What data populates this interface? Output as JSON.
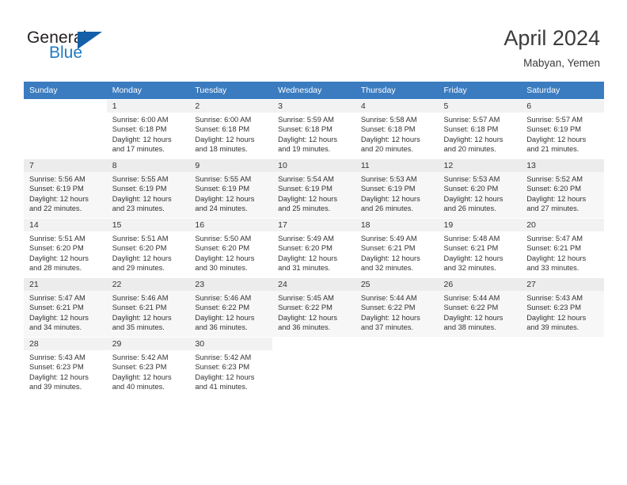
{
  "brand": {
    "name_top": "General",
    "name_bottom": "Blue",
    "triangle_color": "#1360a8",
    "blue_color": "#1f7ac4"
  },
  "header": {
    "title": "April 2024",
    "location": "Mabyan, Yemen"
  },
  "calendar": {
    "header_bg": "#3b7cc0",
    "header_text_color": "#ffffff",
    "weekday_headers": [
      "Sunday",
      "Monday",
      "Tuesday",
      "Wednesday",
      "Thursday",
      "Friday",
      "Saturday"
    ],
    "labels": {
      "sunrise": "Sunrise:",
      "sunset": "Sunset:",
      "daylight": "Daylight:"
    },
    "weeks": [
      [
        {
          "day": "",
          "empty": true
        },
        {
          "day": "1",
          "sunrise": "Sunrise: 6:00 AM",
          "sunset": "Sunset: 6:18 PM",
          "daylight_line1": "Daylight: 12 hours",
          "daylight_line2": "and 17 minutes."
        },
        {
          "day": "2",
          "sunrise": "Sunrise: 6:00 AM",
          "sunset": "Sunset: 6:18 PM",
          "daylight_line1": "Daylight: 12 hours",
          "daylight_line2": "and 18 minutes."
        },
        {
          "day": "3",
          "sunrise": "Sunrise: 5:59 AM",
          "sunset": "Sunset: 6:18 PM",
          "daylight_line1": "Daylight: 12 hours",
          "daylight_line2": "and 19 minutes."
        },
        {
          "day": "4",
          "sunrise": "Sunrise: 5:58 AM",
          "sunset": "Sunset: 6:18 PM",
          "daylight_line1": "Daylight: 12 hours",
          "daylight_line2": "and 20 minutes."
        },
        {
          "day": "5",
          "sunrise": "Sunrise: 5:57 AM",
          "sunset": "Sunset: 6:18 PM",
          "daylight_line1": "Daylight: 12 hours",
          "daylight_line2": "and 20 minutes."
        },
        {
          "day": "6",
          "sunrise": "Sunrise: 5:57 AM",
          "sunset": "Sunset: 6:19 PM",
          "daylight_line1": "Daylight: 12 hours",
          "daylight_line2": "and 21 minutes."
        }
      ],
      [
        {
          "day": "7",
          "sunrise": "Sunrise: 5:56 AM",
          "sunset": "Sunset: 6:19 PM",
          "daylight_line1": "Daylight: 12 hours",
          "daylight_line2": "and 22 minutes."
        },
        {
          "day": "8",
          "sunrise": "Sunrise: 5:55 AM",
          "sunset": "Sunset: 6:19 PM",
          "daylight_line1": "Daylight: 12 hours",
          "daylight_line2": "and 23 minutes."
        },
        {
          "day": "9",
          "sunrise": "Sunrise: 5:55 AM",
          "sunset": "Sunset: 6:19 PM",
          "daylight_line1": "Daylight: 12 hours",
          "daylight_line2": "and 24 minutes."
        },
        {
          "day": "10",
          "sunrise": "Sunrise: 5:54 AM",
          "sunset": "Sunset: 6:19 PM",
          "daylight_line1": "Daylight: 12 hours",
          "daylight_line2": "and 25 minutes."
        },
        {
          "day": "11",
          "sunrise": "Sunrise: 5:53 AM",
          "sunset": "Sunset: 6:19 PM",
          "daylight_line1": "Daylight: 12 hours",
          "daylight_line2": "and 26 minutes."
        },
        {
          "day": "12",
          "sunrise": "Sunrise: 5:53 AM",
          "sunset": "Sunset: 6:20 PM",
          "daylight_line1": "Daylight: 12 hours",
          "daylight_line2": "and 26 minutes."
        },
        {
          "day": "13",
          "sunrise": "Sunrise: 5:52 AM",
          "sunset": "Sunset: 6:20 PM",
          "daylight_line1": "Daylight: 12 hours",
          "daylight_line2": "and 27 minutes."
        }
      ],
      [
        {
          "day": "14",
          "sunrise": "Sunrise: 5:51 AM",
          "sunset": "Sunset: 6:20 PM",
          "daylight_line1": "Daylight: 12 hours",
          "daylight_line2": "and 28 minutes."
        },
        {
          "day": "15",
          "sunrise": "Sunrise: 5:51 AM",
          "sunset": "Sunset: 6:20 PM",
          "daylight_line1": "Daylight: 12 hours",
          "daylight_line2": "and 29 minutes."
        },
        {
          "day": "16",
          "sunrise": "Sunrise: 5:50 AM",
          "sunset": "Sunset: 6:20 PM",
          "daylight_line1": "Daylight: 12 hours",
          "daylight_line2": "and 30 minutes."
        },
        {
          "day": "17",
          "sunrise": "Sunrise: 5:49 AM",
          "sunset": "Sunset: 6:20 PM",
          "daylight_line1": "Daylight: 12 hours",
          "daylight_line2": "and 31 minutes."
        },
        {
          "day": "18",
          "sunrise": "Sunrise: 5:49 AM",
          "sunset": "Sunset: 6:21 PM",
          "daylight_line1": "Daylight: 12 hours",
          "daylight_line2": "and 32 minutes."
        },
        {
          "day": "19",
          "sunrise": "Sunrise: 5:48 AM",
          "sunset": "Sunset: 6:21 PM",
          "daylight_line1": "Daylight: 12 hours",
          "daylight_line2": "and 32 minutes."
        },
        {
          "day": "20",
          "sunrise": "Sunrise: 5:47 AM",
          "sunset": "Sunset: 6:21 PM",
          "daylight_line1": "Daylight: 12 hours",
          "daylight_line2": "and 33 minutes."
        }
      ],
      [
        {
          "day": "21",
          "sunrise": "Sunrise: 5:47 AM",
          "sunset": "Sunset: 6:21 PM",
          "daylight_line1": "Daylight: 12 hours",
          "daylight_line2": "and 34 minutes."
        },
        {
          "day": "22",
          "sunrise": "Sunrise: 5:46 AM",
          "sunset": "Sunset: 6:21 PM",
          "daylight_line1": "Daylight: 12 hours",
          "daylight_line2": "and 35 minutes."
        },
        {
          "day": "23",
          "sunrise": "Sunrise: 5:46 AM",
          "sunset": "Sunset: 6:22 PM",
          "daylight_line1": "Daylight: 12 hours",
          "daylight_line2": "and 36 minutes."
        },
        {
          "day": "24",
          "sunrise": "Sunrise: 5:45 AM",
          "sunset": "Sunset: 6:22 PM",
          "daylight_line1": "Daylight: 12 hours",
          "daylight_line2": "and 36 minutes."
        },
        {
          "day": "25",
          "sunrise": "Sunrise: 5:44 AM",
          "sunset": "Sunset: 6:22 PM",
          "daylight_line1": "Daylight: 12 hours",
          "daylight_line2": "and 37 minutes."
        },
        {
          "day": "26",
          "sunrise": "Sunrise: 5:44 AM",
          "sunset": "Sunset: 6:22 PM",
          "daylight_line1": "Daylight: 12 hours",
          "daylight_line2": "and 38 minutes."
        },
        {
          "day": "27",
          "sunrise": "Sunrise: 5:43 AM",
          "sunset": "Sunset: 6:23 PM",
          "daylight_line1": "Daylight: 12 hours",
          "daylight_line2": "and 39 minutes."
        }
      ],
      [
        {
          "day": "28",
          "sunrise": "Sunrise: 5:43 AM",
          "sunset": "Sunset: 6:23 PM",
          "daylight_line1": "Daylight: 12 hours",
          "daylight_line2": "and 39 minutes."
        },
        {
          "day": "29",
          "sunrise": "Sunrise: 5:42 AM",
          "sunset": "Sunset: 6:23 PM",
          "daylight_line1": "Daylight: 12 hours",
          "daylight_line2": "and 40 minutes."
        },
        {
          "day": "30",
          "sunrise": "Sunrise: 5:42 AM",
          "sunset": "Sunset: 6:23 PM",
          "daylight_line1": "Daylight: 12 hours",
          "daylight_line2": "and 41 minutes."
        },
        {
          "day": "",
          "empty": true
        },
        {
          "day": "",
          "empty": true
        },
        {
          "day": "",
          "empty": true
        },
        {
          "day": "",
          "empty": true
        }
      ]
    ]
  }
}
